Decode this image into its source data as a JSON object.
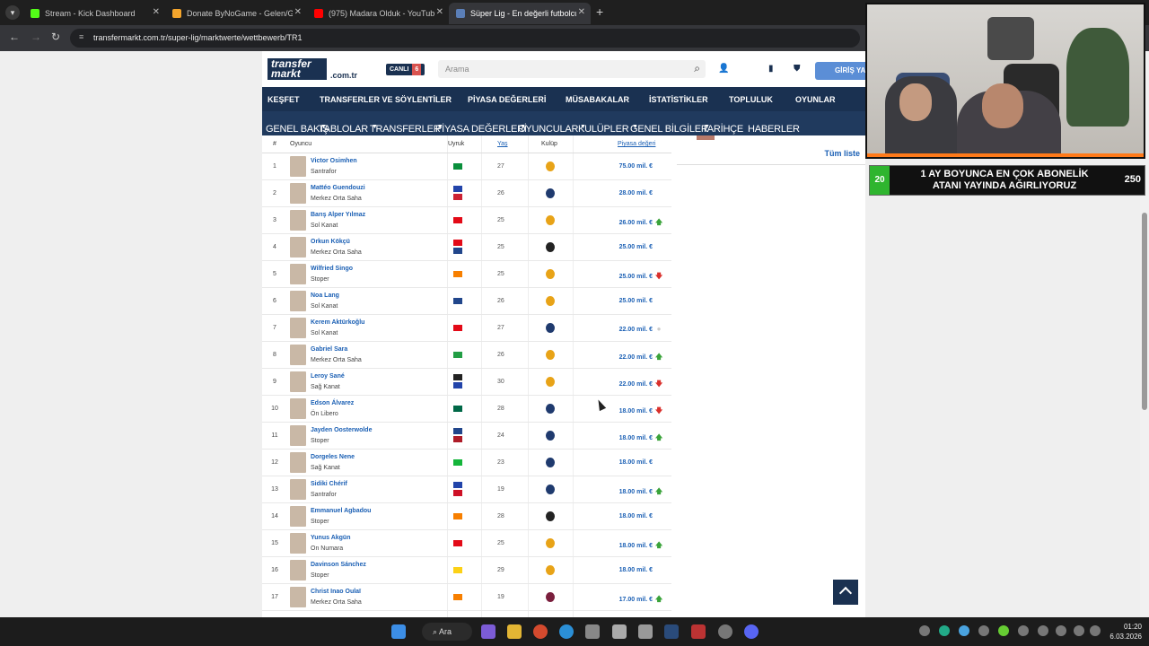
{
  "browser": {
    "tabs": [
      {
        "label": "Stream - Kick Dashboard",
        "color": "#53fc18"
      },
      {
        "label": "Donate ByNoGame - Gelen/Gid",
        "color": "#f4a52c"
      },
      {
        "label": "(975) Madara Olduk - YouTube",
        "color": "#ff0000"
      },
      {
        "label": "Süper Lig - En değerli futbolcul",
        "color": "#1a3151"
      }
    ],
    "url": "transfermarkt.com.tr/super-lig/marktwerte/wettbewerb/TR1"
  },
  "site": {
    "logo_line1": "transfer",
    "logo_line2": "markt",
    "logo_tld": ".com.tr",
    "live_label": "CANLI",
    "live_count": "6",
    "search_placeholder": "Arama",
    "login_label": "GİRİŞ YA",
    "main_nav": [
      "KEŞFET",
      "TRANSFERLER VE SÖYLENTİLER",
      "PİYASA DEĞERLERİ",
      "MÜSABAKALAR",
      "İSTATİSTİKLER",
      "TOPLULUK",
      "OYUNLAR"
    ],
    "sub_nav": [
      "GENEL BAKIŞ",
      "TABLOLAR",
      "TRANSFERLER",
      "PİYASA DEĞERLERİ",
      "OYUNCULAR",
      "KULÜPLER",
      "GENEL BİLGİLER",
      "TARİHÇE",
      "HABERLER"
    ],
    "side_link": "Tüm liste"
  },
  "table": {
    "headers": {
      "rank": "#",
      "player": "Oyuncu",
      "nationality": "Uyruk",
      "age": "Yaş",
      "club": "Kulüp",
      "value": "Piyasa değeri"
    },
    "rows": [
      {
        "rank": "1",
        "name": "Victor Osimhen",
        "pos": "Santrafor",
        "age": "27",
        "value": "75.00 mil. €",
        "trend": "",
        "club": "gs",
        "flags": [
          "#0a8f3c"
        ]
      },
      {
        "rank": "2",
        "name": "Mattéo Guendouzi",
        "pos": "Merkez Orta Saha",
        "age": "26",
        "value": "28.00 mil. €",
        "trend": "",
        "club": "fb",
        "flags": [
          "#2244aa",
          "#cc2233"
        ]
      },
      {
        "rank": "3",
        "name": "Barış Alper Yılmaz",
        "pos": "Sol Kanat",
        "age": "25",
        "value": "26.00 mil. €",
        "trend": "up",
        "club": "gs",
        "flags": [
          "#e30a17"
        ]
      },
      {
        "rank": "4",
        "name": "Orkun Kökçü",
        "pos": "Merkez Orta Saha",
        "age": "25",
        "value": "25.00 mil. €",
        "trend": "",
        "club": "bjk",
        "flags": [
          "#e30a17",
          "#21468b"
        ]
      },
      {
        "rank": "5",
        "name": "Wilfried Singo",
        "pos": "Stoper",
        "age": "25",
        "value": "25.00 mil. €",
        "trend": "down",
        "club": "gs",
        "flags": [
          "#f77f00"
        ]
      },
      {
        "rank": "6",
        "name": "Noa Lang",
        "pos": "Sol Kanat",
        "age": "26",
        "value": "25.00 mil. €",
        "trend": "",
        "club": "gs",
        "flags": [
          "#21468b"
        ]
      },
      {
        "rank": "7",
        "name": "Kerem Aktürkoğlu",
        "pos": "Sol Kanat",
        "age": "27",
        "value": "22.00 mil. €",
        "trend": "same",
        "club": "fb",
        "flags": [
          "#e30a17"
        ]
      },
      {
        "rank": "8",
        "name": "Gabriel Sara",
        "pos": "Merkez Orta Saha",
        "age": "26",
        "value": "22.00 mil. €",
        "trend": "up",
        "club": "gs",
        "flags": [
          "#229e45"
        ]
      },
      {
        "rank": "9",
        "name": "Leroy Sané",
        "pos": "Sağ Kanat",
        "age": "30",
        "value": "22.00 mil. €",
        "trend": "down",
        "club": "gs",
        "flags": [
          "#222222",
          "#2244aa"
        ]
      },
      {
        "rank": "10",
        "name": "Edson Álvarez",
        "pos": "Ön Libero",
        "age": "28",
        "value": "18.00 mil. €",
        "trend": "down",
        "club": "fb",
        "flags": [
          "#006847"
        ]
      },
      {
        "rank": "11",
        "name": "Jayden Oosterwolde",
        "pos": "Stoper",
        "age": "24",
        "value": "18.00 mil. €",
        "trend": "up",
        "club": "fb",
        "flags": [
          "#21468b",
          "#ae1c28"
        ]
      },
      {
        "rank": "12",
        "name": "Dorgeles Nene",
        "pos": "Sağ Kanat",
        "age": "23",
        "value": "18.00 mil. €",
        "trend": "",
        "club": "fb",
        "flags": [
          "#14b53a"
        ]
      },
      {
        "rank": "13",
        "name": "Sidiki Chérif",
        "pos": "Santrafor",
        "age": "19",
        "value": "18.00 mil. €",
        "trend": "up",
        "club": "fb",
        "flags": [
          "#2244aa",
          "#ce1126"
        ]
      },
      {
        "rank": "14",
        "name": "Emmanuel Agbadou",
        "pos": "Stoper",
        "age": "28",
        "value": "18.00 mil. €",
        "trend": "",
        "club": "bjk",
        "flags": [
          "#f77f00"
        ]
      },
      {
        "rank": "15",
        "name": "Yunus Akgün",
        "pos": "On Numara",
        "age": "25",
        "value": "18.00 mil. €",
        "trend": "up",
        "club": "gs",
        "flags": [
          "#e30a17"
        ]
      },
      {
        "rank": "16",
        "name": "Davinson Sánchez",
        "pos": "Stoper",
        "age": "29",
        "value": "18.00 mil. €",
        "trend": "",
        "club": "gs",
        "flags": [
          "#fcd116"
        ]
      },
      {
        "rank": "17",
        "name": "Christ Inao Oulaï",
        "pos": "Merkez Orta Saha",
        "age": "19",
        "value": "17.00 mil. €",
        "trend": "up",
        "club": "ts",
        "flags": [
          "#f77f00"
        ]
      }
    ]
  },
  "overlay": {
    "sub_left": "20",
    "sub_message": "1 AY BOYUNCA EN ÇOK ABONELİK ATANI YAYINDA AĞIRLIYORUZ",
    "sub_right": "250"
  },
  "taskbar": {
    "search_label": "Ara",
    "time": "01:20",
    "date": "6.03.2026"
  },
  "colors": {
    "brand": "#1a3151",
    "link": "#1a5fb4",
    "up": "#3aa33a",
    "down": "#d9302c",
    "gs": "#e8a317",
    "fb": "#1f3a6e",
    "bjk": "#222222",
    "ts": "#7a1f3d"
  }
}
